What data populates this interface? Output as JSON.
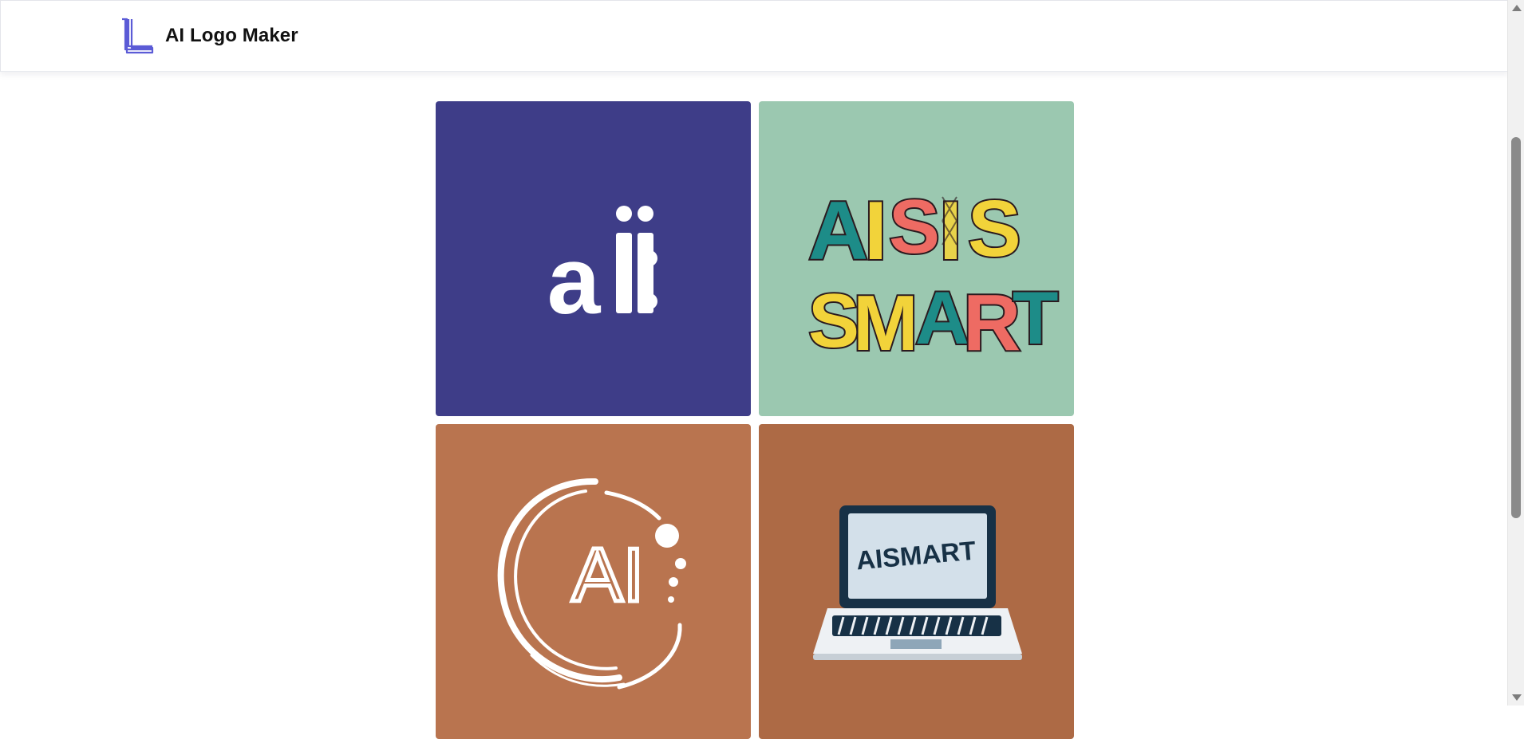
{
  "header": {
    "brand_name": "AI Logo Maker",
    "logo_icon": "stacked-l-logo-icon",
    "accent": "#5b5bd6"
  },
  "gallery": {
    "tiles": [
      {
        "name": "ai-dots-logo",
        "background": "#3e3d88",
        "text": "aii:"
      },
      {
        "name": "aisis-smart-logo",
        "background": "#9bc8b0",
        "text_line1": "AISIS",
        "text_line2": "SMART"
      },
      {
        "name": "ai-circle-logo",
        "background": "#b9744f",
        "text": "AI"
      },
      {
        "name": "aismart-laptop-logo",
        "background": "#ad6a45",
        "text": "AISMART"
      }
    ]
  }
}
